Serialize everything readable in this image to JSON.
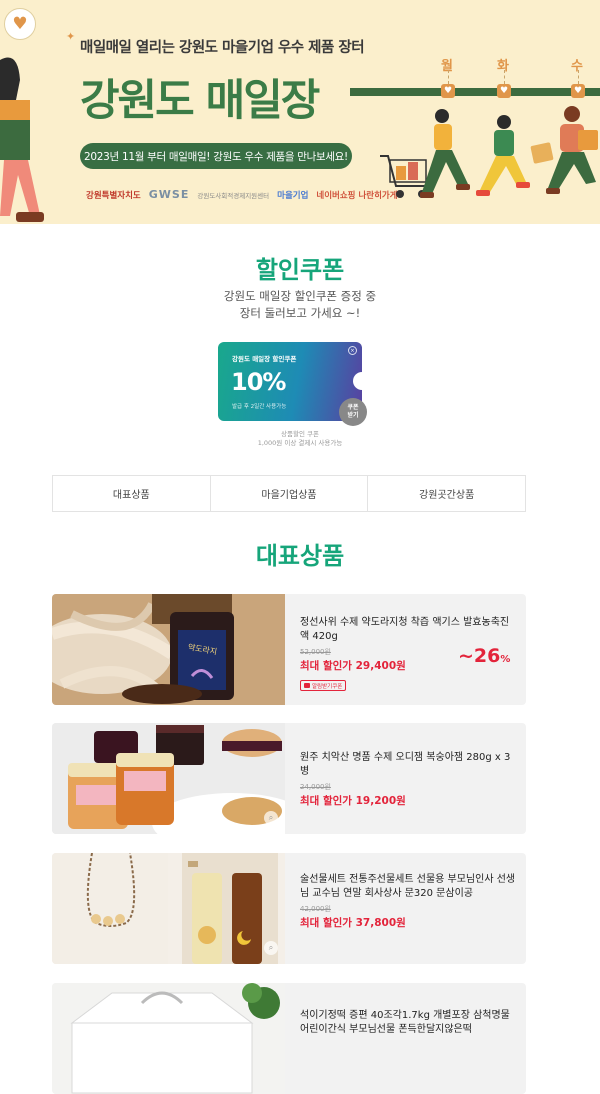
{
  "banner": {
    "subtitle": "매일매일 열리는 강원도 마을기업 우수 제품 장터",
    "title": "강원도 매일장",
    "pill_text": "2023년 11월 부터 매일매일! 강원도 우수 제품을 만나보세요!",
    "days": [
      "월",
      "화",
      "수"
    ],
    "logos": [
      "강원특별자치도",
      "GWSE",
      "강원도사회적경제지원센터",
      "마을기업",
      "네이버쇼핑 나란히가게"
    ]
  },
  "coupon_section": {
    "heading": "할인쿠폰",
    "description": "강원도 매일장 할인쿠폰 증정 중\n장터 둘러보고 가세요 ~!",
    "card": {
      "label": "강원도 매일장 할인쿠폰",
      "percent": "10%",
      "validity": "발급 후 2일간 사용가능"
    },
    "get_button": "쿠폰\n받기",
    "note": "상품할인 쿠폰\n1,000원 이상 결제시 사용가능"
  },
  "tabs": [
    "대표상품",
    "마을기업상품",
    "강원곳간상품"
  ],
  "featured": {
    "heading": "대표상품",
    "products": [
      {
        "name": "정선사위 수제 약도라지청 착즙 액기스 발효농축진액 420g",
        "original_price": "52,000원",
        "max_label": "최대 할인가",
        "sale_price": "29,400원",
        "discount": "~26",
        "discount_unit": "%",
        "badge": "알림받기쿠폰"
      },
      {
        "name": "원주 치악산 명품 수제 오디잼 복숭아잼 280g x 3병",
        "original_price": "24,000원",
        "max_label": "최대 할인가",
        "sale_price": "19,200원"
      },
      {
        "name": "술선물세트 전통주선물세트 선물용 부모님인사 선생님 교수님 연말 회사상사 문320 문삼이공",
        "original_price": "42,000원",
        "max_label": "최대 할인가",
        "sale_price": "37,800원"
      },
      {
        "name": "석이기정떡 증편 40조각1.7kg 개별포장 삼척명물 어린이간식 부모님선물 폰득한달지않은떡"
      }
    ]
  },
  "colors": {
    "brand_green": "#16a57a",
    "banner_green": "#3b7c47",
    "sale_red": "#e3243b",
    "banner_bg": "#fbefcc"
  }
}
